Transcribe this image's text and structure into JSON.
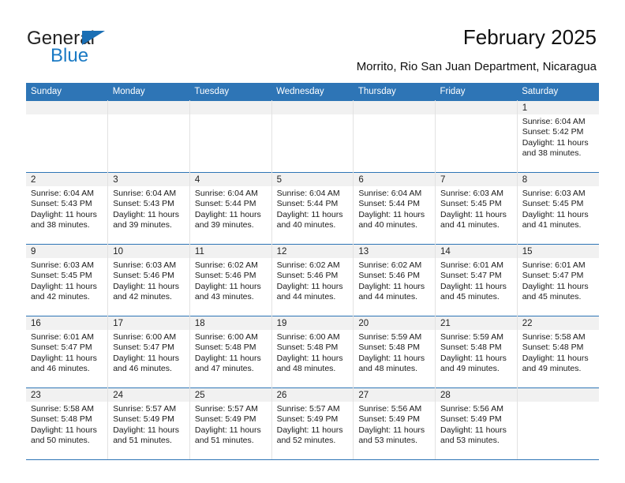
{
  "brand": {
    "name_part1": "General",
    "name_part2": "Blue",
    "triangle_color": "#1a6fb5",
    "blue_color": "#1a7ac4"
  },
  "header": {
    "title": "February 2025",
    "subtitle": "Morrito, Rio San Juan Department, Nicaragua",
    "accent_color": "#2e75b6"
  },
  "calendar": {
    "weekday_headers": [
      "Sunday",
      "Monday",
      "Tuesday",
      "Wednesday",
      "Thursday",
      "Friday",
      "Saturday"
    ],
    "weeks": [
      [
        {
          "day": "",
          "empty": true
        },
        {
          "day": "",
          "empty": true
        },
        {
          "day": "",
          "empty": true
        },
        {
          "day": "",
          "empty": true
        },
        {
          "day": "",
          "empty": true
        },
        {
          "day": "",
          "empty": true
        },
        {
          "day": "1",
          "sunrise": "Sunrise: 6:04 AM",
          "sunset": "Sunset: 5:42 PM",
          "daylight": "Daylight: 11 hours and 38 minutes."
        }
      ],
      [
        {
          "day": "2",
          "sunrise": "Sunrise: 6:04 AM",
          "sunset": "Sunset: 5:43 PM",
          "daylight": "Daylight: 11 hours and 38 minutes."
        },
        {
          "day": "3",
          "sunrise": "Sunrise: 6:04 AM",
          "sunset": "Sunset: 5:43 PM",
          "daylight": "Daylight: 11 hours and 39 minutes."
        },
        {
          "day": "4",
          "sunrise": "Sunrise: 6:04 AM",
          "sunset": "Sunset: 5:44 PM",
          "daylight": "Daylight: 11 hours and 39 minutes."
        },
        {
          "day": "5",
          "sunrise": "Sunrise: 6:04 AM",
          "sunset": "Sunset: 5:44 PM",
          "daylight": "Daylight: 11 hours and 40 minutes."
        },
        {
          "day": "6",
          "sunrise": "Sunrise: 6:04 AM",
          "sunset": "Sunset: 5:44 PM",
          "daylight": "Daylight: 11 hours and 40 minutes."
        },
        {
          "day": "7",
          "sunrise": "Sunrise: 6:03 AM",
          "sunset": "Sunset: 5:45 PM",
          "daylight": "Daylight: 11 hours and 41 minutes."
        },
        {
          "day": "8",
          "sunrise": "Sunrise: 6:03 AM",
          "sunset": "Sunset: 5:45 PM",
          "daylight": "Daylight: 11 hours and 41 minutes."
        }
      ],
      [
        {
          "day": "9",
          "sunrise": "Sunrise: 6:03 AM",
          "sunset": "Sunset: 5:45 PM",
          "daylight": "Daylight: 11 hours and 42 minutes."
        },
        {
          "day": "10",
          "sunrise": "Sunrise: 6:03 AM",
          "sunset": "Sunset: 5:46 PM",
          "daylight": "Daylight: 11 hours and 42 minutes."
        },
        {
          "day": "11",
          "sunrise": "Sunrise: 6:02 AM",
          "sunset": "Sunset: 5:46 PM",
          "daylight": "Daylight: 11 hours and 43 minutes."
        },
        {
          "day": "12",
          "sunrise": "Sunrise: 6:02 AM",
          "sunset": "Sunset: 5:46 PM",
          "daylight": "Daylight: 11 hours and 44 minutes."
        },
        {
          "day": "13",
          "sunrise": "Sunrise: 6:02 AM",
          "sunset": "Sunset: 5:46 PM",
          "daylight": "Daylight: 11 hours and 44 minutes."
        },
        {
          "day": "14",
          "sunrise": "Sunrise: 6:01 AM",
          "sunset": "Sunset: 5:47 PM",
          "daylight": "Daylight: 11 hours and 45 minutes."
        },
        {
          "day": "15",
          "sunrise": "Sunrise: 6:01 AM",
          "sunset": "Sunset: 5:47 PM",
          "daylight": "Daylight: 11 hours and 45 minutes."
        }
      ],
      [
        {
          "day": "16",
          "sunrise": "Sunrise: 6:01 AM",
          "sunset": "Sunset: 5:47 PM",
          "daylight": "Daylight: 11 hours and 46 minutes."
        },
        {
          "day": "17",
          "sunrise": "Sunrise: 6:00 AM",
          "sunset": "Sunset: 5:47 PM",
          "daylight": "Daylight: 11 hours and 46 minutes."
        },
        {
          "day": "18",
          "sunrise": "Sunrise: 6:00 AM",
          "sunset": "Sunset: 5:48 PM",
          "daylight": "Daylight: 11 hours and 47 minutes."
        },
        {
          "day": "19",
          "sunrise": "Sunrise: 6:00 AM",
          "sunset": "Sunset: 5:48 PM",
          "daylight": "Daylight: 11 hours and 48 minutes."
        },
        {
          "day": "20",
          "sunrise": "Sunrise: 5:59 AM",
          "sunset": "Sunset: 5:48 PM",
          "daylight": "Daylight: 11 hours and 48 minutes."
        },
        {
          "day": "21",
          "sunrise": "Sunrise: 5:59 AM",
          "sunset": "Sunset: 5:48 PM",
          "daylight": "Daylight: 11 hours and 49 minutes."
        },
        {
          "day": "22",
          "sunrise": "Sunrise: 5:58 AM",
          "sunset": "Sunset: 5:48 PM",
          "daylight": "Daylight: 11 hours and 49 minutes."
        }
      ],
      [
        {
          "day": "23",
          "sunrise": "Sunrise: 5:58 AM",
          "sunset": "Sunset: 5:48 PM",
          "daylight": "Daylight: 11 hours and 50 minutes."
        },
        {
          "day": "24",
          "sunrise": "Sunrise: 5:57 AM",
          "sunset": "Sunset: 5:49 PM",
          "daylight": "Daylight: 11 hours and 51 minutes."
        },
        {
          "day": "25",
          "sunrise": "Sunrise: 5:57 AM",
          "sunset": "Sunset: 5:49 PM",
          "daylight": "Daylight: 11 hours and 51 minutes."
        },
        {
          "day": "26",
          "sunrise": "Sunrise: 5:57 AM",
          "sunset": "Sunset: 5:49 PM",
          "daylight": "Daylight: 11 hours and 52 minutes."
        },
        {
          "day": "27",
          "sunrise": "Sunrise: 5:56 AM",
          "sunset": "Sunset: 5:49 PM",
          "daylight": "Daylight: 11 hours and 53 minutes."
        },
        {
          "day": "28",
          "sunrise": "Sunrise: 5:56 AM",
          "sunset": "Sunset: 5:49 PM",
          "daylight": "Daylight: 11 hours and 53 minutes."
        },
        {
          "day": "",
          "empty": true
        }
      ]
    ]
  }
}
